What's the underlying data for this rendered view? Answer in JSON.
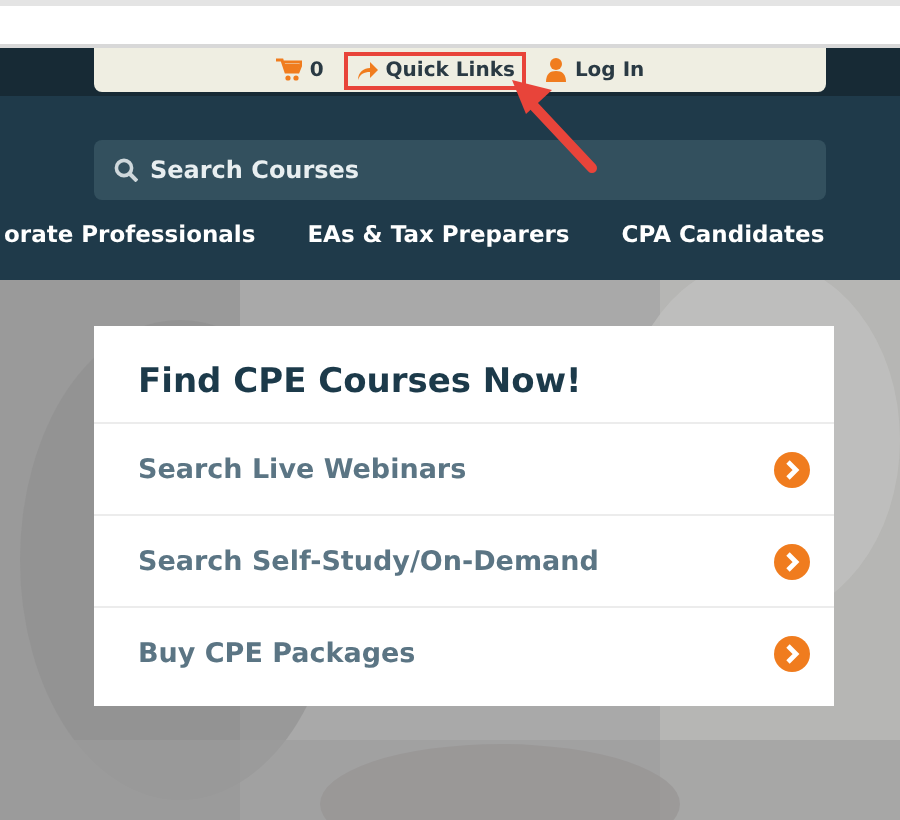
{
  "utility_bar": {
    "cart_count": "0",
    "quick_links": "Quick Links",
    "login": "Log In"
  },
  "search": {
    "placeholder": "Search Courses"
  },
  "nav": [
    "orate Professionals",
    "EAs & Tax Preparers",
    "CPA Candidates"
  ],
  "card": {
    "title": "Find CPE Courses Now!",
    "links": [
      {
        "label": "Search Live Webinars"
      },
      {
        "label": "Search Self-Study/On-Demand"
      },
      {
        "label": "Buy CPE Packages"
      }
    ]
  },
  "annotation": {
    "quick_links_highlighted": true,
    "color": "#e8443a"
  }
}
